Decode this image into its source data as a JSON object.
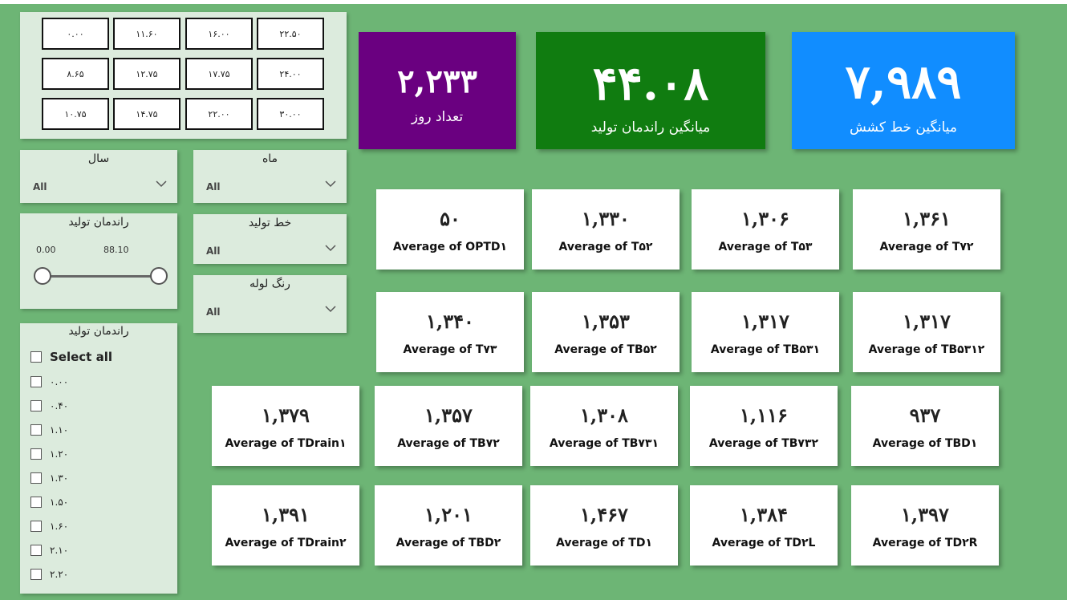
{
  "tiles": [
    "۰.۰۰",
    "۱۱.۶۰",
    "۱۶.۰۰",
    "۲۲.۵۰",
    "۸.۶۵",
    "۱۲.۷۵",
    "۱۷.۷۵",
    "۲۴.۰۰",
    "۱۰.۷۵",
    "۱۴.۷۵",
    "۲۲.۰۰",
    "۳۰.۰۰"
  ],
  "filters": {
    "year": {
      "title": "سال",
      "value": "All"
    },
    "month": {
      "title": "ماه",
      "value": "All"
    },
    "line": {
      "title": "خط تولید",
      "value": "All"
    },
    "color": {
      "title": "رنگ لوله",
      "value": "All"
    }
  },
  "slider": {
    "title": "راندمان تولید",
    "min": "0.00",
    "max": "88.10"
  },
  "checklist": {
    "title": "راندمان تولید",
    "select_all": "Select all",
    "items": [
      "۰.۰۰",
      "۰.۴۰",
      "۱.۱۰",
      "۱.۲۰",
      "۱.۳۰",
      "۱.۵۰",
      "۱.۶۰",
      "۲.۱۰",
      "۲.۲۰"
    ]
  },
  "kpis": [
    {
      "value": "۲,۲۳۳",
      "label": "تعداد روز",
      "color": "#6a0080"
    },
    {
      "value": "۴۴.۰۸",
      "label": "میانگین راندمان تولید",
      "color": "#107c10"
    },
    {
      "value": "۷,۹۸۹",
      "label": "میانگین خط کشش",
      "color": "#118dff"
    }
  ],
  "cards": [
    {
      "value": "۵۰",
      "label": "Average of OPTD۱"
    },
    {
      "value": "۱,۳۳۰",
      "label": "Average of T۵۲"
    },
    {
      "value": "۱,۳۰۶",
      "label": "Average of T۵۳"
    },
    {
      "value": "۱,۳۶۱",
      "label": "Average of T۷۲"
    },
    {
      "value": "۱,۳۴۰",
      "label": "Average of T۷۳"
    },
    {
      "value": "۱,۳۵۳",
      "label": "Average of TB۵۲"
    },
    {
      "value": "۱,۳۱۷",
      "label": "Average of TB۵۳۱"
    },
    {
      "value": "۱,۳۱۷",
      "label": "Average of TB۵۳۱۲"
    },
    {
      "value": "۱,۳۷۹",
      "label": "Average of TDrain۱"
    },
    {
      "value": "۱,۳۵۷",
      "label": "Average of TB۷۲"
    },
    {
      "value": "۱,۳۰۸",
      "label": "Average of TB۷۳۱"
    },
    {
      "value": "۱,۱۱۶",
      "label": "Average of TB۷۳۲"
    },
    {
      "value": "۹۳۷",
      "label": "Average of TBD۱"
    },
    {
      "value": "۱,۳۹۱",
      "label": "Average of TDrain۲"
    },
    {
      "value": "۱,۲۰۱",
      "label": "Average of TBD۲"
    },
    {
      "value": "۱,۴۶۷",
      "label": "Average of TD۱"
    },
    {
      "value": "۱,۳۸۴",
      "label": "Average of TD۲L"
    },
    {
      "value": "۱,۳۹۷",
      "label": "Average of TD۲R"
    }
  ]
}
